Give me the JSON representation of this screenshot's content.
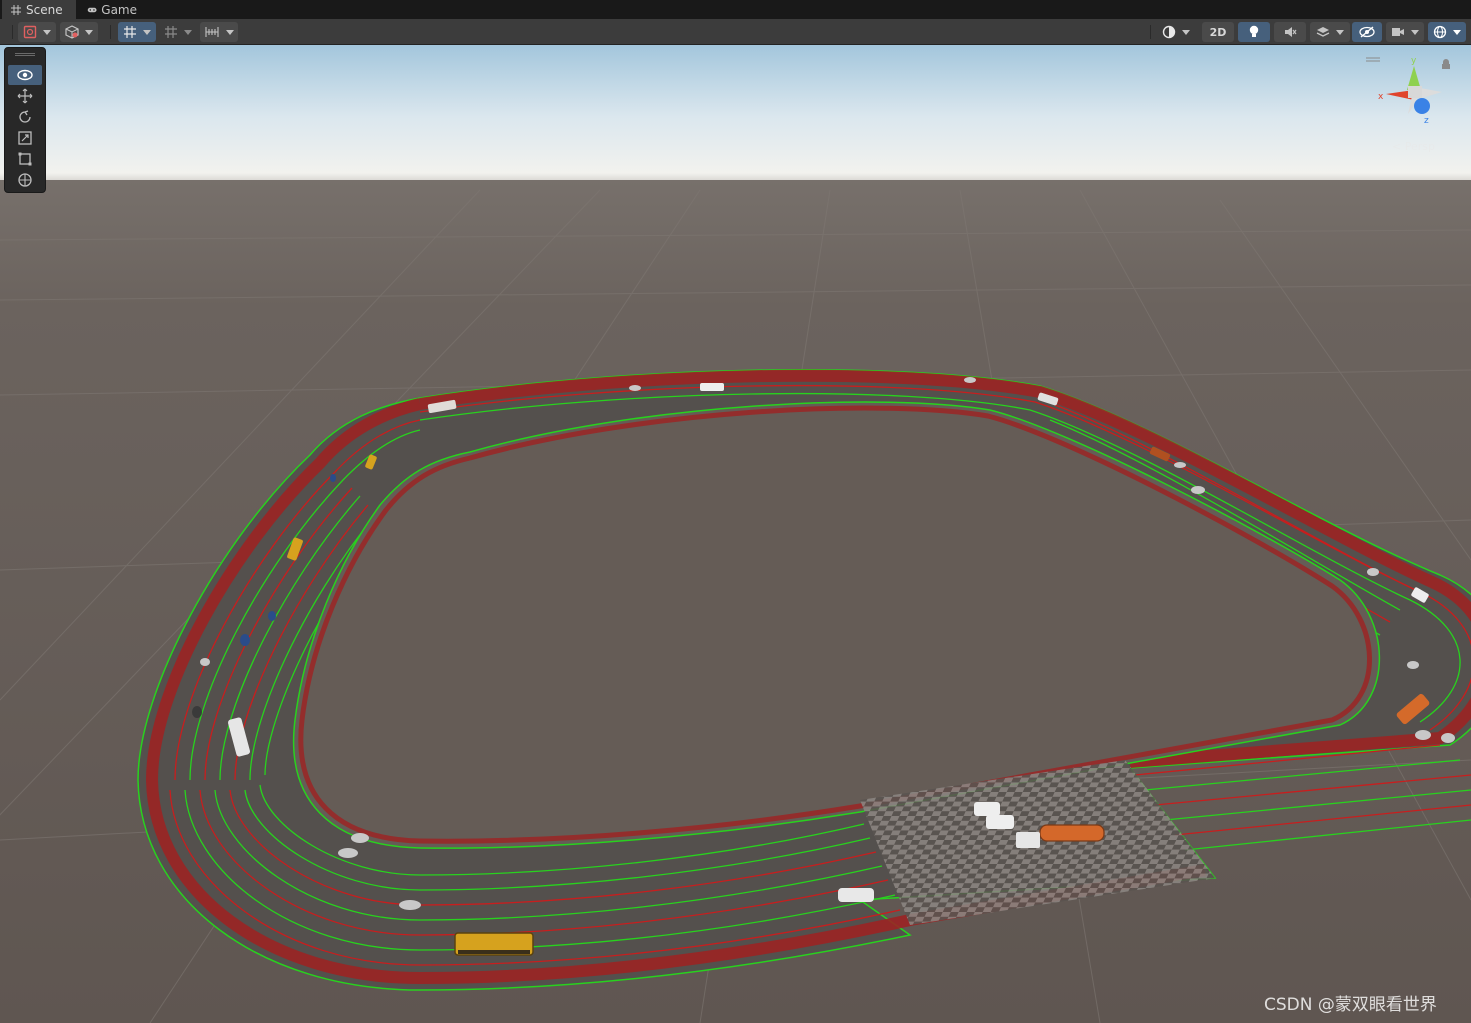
{
  "tabs": [
    {
      "label": "Scene",
      "icon": "grid-icon",
      "active": true
    },
    {
      "label": "Game",
      "icon": "gamepad-icon",
      "active": false
    }
  ],
  "toolbar": {
    "left": [
      {
        "icon": "draw-mode-icon",
        "dropdown": true
      },
      {
        "icon": "render-cube-icon",
        "dropdown": true
      },
      {
        "icon": "grid-snap-icon",
        "dropdown": true,
        "active": true
      },
      {
        "icon": "increment-snap-icon",
        "dropdown": true
      },
      {
        "icon": "vertex-snap-icon",
        "dropdown": true
      }
    ],
    "right": [
      {
        "icon": "shading-sphere-icon",
        "dropdown": true
      },
      {
        "label": "2D"
      },
      {
        "icon": "lighting-bulb-icon",
        "active": true
      },
      {
        "icon": "audio-mute-icon"
      },
      {
        "icon": "effects-layers-icon",
        "dropdown": true
      },
      {
        "icon": "hidden-objects-eye-icon",
        "active": true
      },
      {
        "icon": "scene-camera-icon",
        "dropdown": true
      },
      {
        "icon": "gizmos-globe-icon",
        "dropdown": true,
        "active": true
      }
    ]
  },
  "tool_palette": [
    {
      "name": "view-tool",
      "icon": "eye-icon",
      "active": true
    },
    {
      "name": "move-tool",
      "icon": "move-arrows-icon",
      "active": false
    },
    {
      "name": "rotate-tool",
      "icon": "rotate-icon",
      "active": false
    },
    {
      "name": "scale-tool",
      "icon": "scale-icon",
      "active": false
    },
    {
      "name": "rect-tool",
      "icon": "rect-icon",
      "active": false
    },
    {
      "name": "transform-tool",
      "icon": "transform-icon",
      "active": false
    }
  ],
  "gizmo": {
    "projection_label": "Persp",
    "axis_labels": {
      "x": "x",
      "y": "y",
      "z": "z"
    },
    "colors": {
      "x": "#e0442d",
      "y": "#8fd14f",
      "z": "#3a82e6"
    }
  },
  "scene": {
    "sky_top": "#9fc3d9",
    "ground": "#645a54",
    "road_color": "#56504c",
    "lane_green": "#28d21e",
    "lane_red": "#c81e1e"
  },
  "watermark": "CSDN @蒙双眼看世界"
}
